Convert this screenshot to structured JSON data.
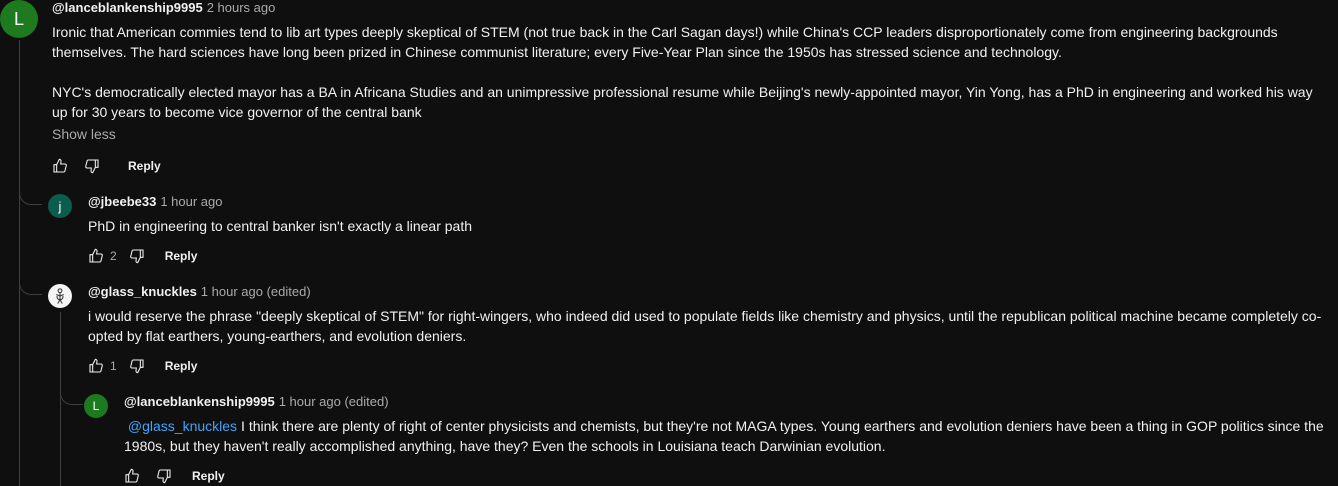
{
  "comments": [
    {
      "avatar_letter": "L",
      "avatar_color": "#1e7a1e",
      "author": "@lanceblankenship9995",
      "time": "2 hours ago",
      "para1": "Ironic that American commies tend to lib art types deeply skeptical of STEM (not true back in the Carl Sagan days!) while China's CCP leaders disproportionately come from engineering backgrounds themselves.  The hard sciences have long been prized in Chinese communist literature; every Five-Year Plan since the 1950s has stressed science and technology.",
      "para2": "NYC's democratically elected mayor has a BA in Africana Studies and an unimpressive professional resume while Beijing's newly-appointed mayor, Yin Yong, has a PhD in engineering and worked his way up for 30 years to become vice governor of the central bank",
      "show_less": "Show less",
      "reply": "Reply"
    },
    {
      "avatar_letter": "j",
      "avatar_color": "#0b5d4e",
      "author": "@jbeebe33",
      "time": "1 hour ago",
      "text": "PhD in engineering to central banker isn't exactly a linear path",
      "likes": "2",
      "reply": "Reply"
    },
    {
      "avatar_icon": "figure-avatar-icon",
      "avatar_color": "#f5f5f5",
      "author": "@glass_knuckles",
      "time": "1 hour ago (edited)",
      "text": "i would reserve the phrase \"deeply skeptical of STEM\" for right-wingers, who indeed did used to populate fields like chemistry and physics, until the republican political machine became completely co-opted by flat earthers, young-earthers, and evolution deniers.",
      "likes": "1",
      "reply": "Reply"
    },
    {
      "avatar_letter": "L",
      "avatar_color": "#1e7a1e",
      "author": "@lanceblankenship9995",
      "time": "1 hour ago (edited)",
      "mention": "@glass_knuckles",
      "text": "I think there are plenty of right of center physicists and chemists, but they're not MAGA types.  Young earthers and evolution deniers have been a thing in GOP politics since the 1980s, but they haven't really accomplished anything, have they?  Even the schools in Louisiana teach Darwinian evolution.",
      "reply": "Reply"
    }
  ]
}
